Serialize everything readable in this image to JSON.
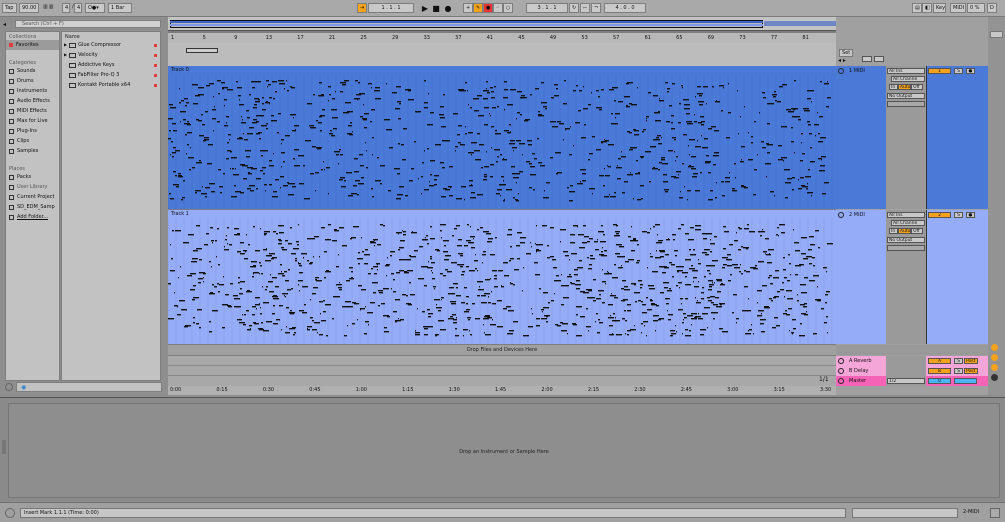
{
  "transport": {
    "tap": "Tap",
    "tempo": "90.00",
    "sig_num": "4",
    "sig_den": "4",
    "quantize": "1 Bar",
    "position": "1 . 1 . 1",
    "loop_start": "3 . 1 . 1",
    "loop_len": "4 . 0 . 0",
    "key_label": "Key",
    "midi_label": "MIDI",
    "cpu": "0 %",
    "disk": "D"
  },
  "browser": {
    "search_placeholder": "Search (Ctrl + F)",
    "collections_header": "Collections",
    "favorites": "Favorites",
    "categories_header": "Categories",
    "categories": [
      "Sounds",
      "Drums",
      "Instruments",
      "Audio Effects",
      "MIDI Effects",
      "Max for Live",
      "Plug-Ins",
      "Clips",
      "Samples"
    ],
    "places_header": "Places",
    "places": [
      "Packs",
      "User Library",
      "Current Project",
      "SD_EDM_Samp",
      "Add Folder..."
    ],
    "name_header": "Name",
    "items": [
      "Glue Compressor",
      "Velocity",
      "Addictive Keys",
      "FabFilter Pro-Q 3",
      "Kontakt Portable x64"
    ]
  },
  "arrangement": {
    "ruler_marks": [
      "1",
      "5",
      "9",
      "13",
      "17",
      "21",
      "25",
      "29",
      "33",
      "37",
      "41",
      "45",
      "49",
      "53",
      "57",
      "61",
      "65",
      "69",
      "73",
      "77",
      "81"
    ],
    "time_marks": [
      "0:00",
      "0:15",
      "0:30",
      "0:45",
      "1:00",
      "1:15",
      "1:30",
      "1:45",
      "2:00",
      "2:15",
      "2:30",
      "2:45",
      "3:00",
      "3:15",
      "3:30"
    ],
    "clip0_name": "Track 0",
    "clip1_name": "Track 1",
    "drop_text": "Drop Files and Devices Here",
    "page_indicator": "1/1"
  },
  "mixer": {
    "set_label": "Set",
    "tracks": [
      {
        "name": "1 MIDI",
        "input": "All Ins",
        "channel": "All Channe",
        "monitor_in": "In",
        "monitor_auto": "Auto",
        "monitor_off": "Off",
        "output": "No Output",
        "number": "1",
        "solo": "S"
      },
      {
        "name": "2 MIDI",
        "input": "All Ins",
        "channel": "All Channe",
        "monitor_in": "In",
        "monitor_auto": "Auto",
        "monitor_off": "Off",
        "output": "No Output",
        "number": "2",
        "solo": "S"
      }
    ],
    "returns": [
      {
        "name": "A Reverb",
        "letter": "A",
        "solo": "S",
        "post": "Post"
      },
      {
        "name": "B Delay",
        "letter": "B",
        "solo": "S",
        "post": "Post"
      }
    ],
    "master": {
      "name": "Master",
      "output": "1/2",
      "value": "0"
    }
  },
  "detail": {
    "drop_text": "Drop an Instrument or Sample Here"
  },
  "status": {
    "text": "Insert Mark 1.1.1 (Time: 0:00)",
    "selected_track": "2-MIDI"
  },
  "colors": {
    "track0": "#4a79d8",
    "track1": "#95acf8",
    "accent": "#f4a21b",
    "return_a": "#f5a6d8",
    "return_b": "#f5a6d8",
    "master": "#f563b7"
  }
}
